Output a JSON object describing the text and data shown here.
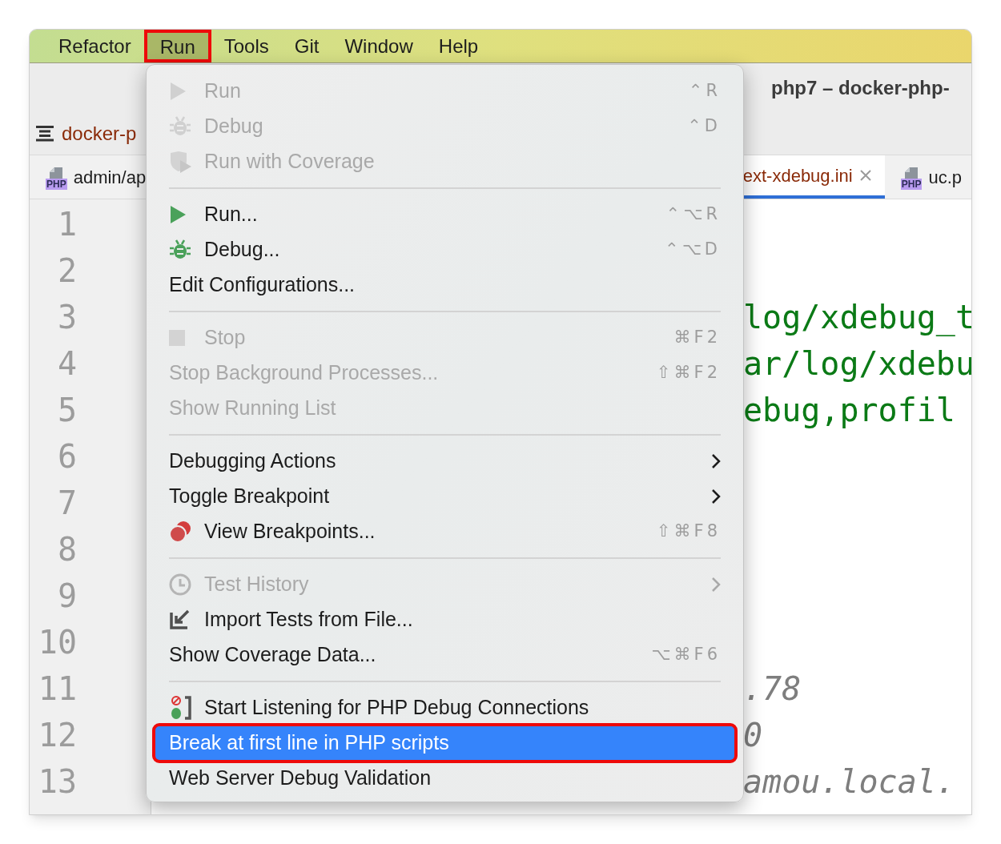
{
  "menubar": [
    {
      "label": "Refactor",
      "selected": false,
      "annotated": false
    },
    {
      "label": "Run",
      "selected": true,
      "annotated": true
    },
    {
      "label": "Tools",
      "selected": false,
      "annotated": false
    },
    {
      "label": "Git",
      "selected": false,
      "annotated": false
    },
    {
      "label": "Window",
      "selected": false,
      "annotated": false
    },
    {
      "label": "Help",
      "selected": false,
      "annotated": false
    }
  ],
  "window": {
    "title": "php7 – docker-php-"
  },
  "navbar": {
    "breadcrumb": "docker-p"
  },
  "tabs": [
    {
      "label": "admin/ap",
      "selected": false,
      "badge": "PHP"
    },
    {
      "label": "ext-xdebug.ini",
      "selected": true,
      "closable": true
    },
    {
      "label": "uc.p",
      "selected": false,
      "badge": "PHP"
    }
  ],
  "editor": {
    "lines": [
      {
        "number": "1"
      },
      {
        "number": "2"
      },
      {
        "number": "3",
        "text": "log/xdebug_t",
        "kind": "string"
      },
      {
        "number": "4",
        "text": "ar/log/xdebu",
        "kind": "string"
      },
      {
        "number": "5",
        "text": "ebug,profil",
        "kind": "string"
      },
      {
        "number": "6"
      },
      {
        "number": "7"
      },
      {
        "number": "8"
      },
      {
        "number": "9"
      },
      {
        "number": "10"
      },
      {
        "number": "11",
        "text": ".78",
        "kind": "value"
      },
      {
        "number": "12",
        "text": "0",
        "kind": "value"
      },
      {
        "number": "13",
        "text": "amou.local.",
        "kind": "value"
      }
    ]
  },
  "menu": {
    "items": [
      {
        "kind": "item",
        "label": "Run",
        "disabled": true,
        "shortcut": "⌃R",
        "selected": false,
        "annotated": false
      },
      {
        "kind": "item",
        "label": "Debug",
        "disabled": true,
        "shortcut": "⌃D",
        "selected": false,
        "annotated": false
      },
      {
        "kind": "item",
        "label": "Run with Coverage",
        "disabled": true,
        "selected": false,
        "annotated": false
      },
      {
        "kind": "separator"
      },
      {
        "kind": "item",
        "label": "Run...",
        "disabled": false,
        "shortcut": "⌃⌥R",
        "selected": false,
        "annotated": false
      },
      {
        "kind": "item",
        "label": "Debug...",
        "disabled": false,
        "shortcut": "⌃⌥D",
        "selected": false,
        "annotated": false
      },
      {
        "kind": "item",
        "label": "Edit Configurations...",
        "disabled": false,
        "selected": false,
        "annotated": false
      },
      {
        "kind": "separator"
      },
      {
        "kind": "item",
        "label": "Stop",
        "disabled": true,
        "shortcut": "⌘F2",
        "selected": false,
        "annotated": false
      },
      {
        "kind": "item",
        "label": "Stop Background Processes...",
        "disabled": true,
        "shortcut": "⇧⌘F2",
        "selected": false,
        "annotated": false
      },
      {
        "kind": "item",
        "label": "Show Running List",
        "disabled": true,
        "selected": false,
        "annotated": false
      },
      {
        "kind": "separator"
      },
      {
        "kind": "item",
        "label": "Debugging Actions",
        "disabled": false,
        "submenu": true,
        "selected": false,
        "annotated": false
      },
      {
        "kind": "item",
        "label": "Toggle Breakpoint",
        "disabled": false,
        "submenu": true,
        "selected": false,
        "annotated": false
      },
      {
        "kind": "item",
        "label": "View Breakpoints...",
        "disabled": false,
        "shortcut": "⇧⌘F8",
        "selected": false,
        "annotated": false
      },
      {
        "kind": "separator"
      },
      {
        "kind": "item",
        "label": "Test History",
        "disabled": true,
        "submenu": true,
        "selected": false,
        "annotated": false
      },
      {
        "kind": "item",
        "label": "Import Tests from File...",
        "disabled": false,
        "selected": false,
        "annotated": false
      },
      {
        "kind": "item",
        "label": "Show Coverage Data...",
        "disabled": false,
        "shortcut": "⌥⌘F6",
        "selected": false,
        "annotated": false
      },
      {
        "kind": "separator"
      },
      {
        "kind": "item",
        "label": "Start Listening for PHP Debug Connections",
        "disabled": false,
        "selected": false,
        "annotated": false
      },
      {
        "kind": "item",
        "label": "Break at first line in PHP scripts",
        "disabled": false,
        "selected": true,
        "annotated": true
      },
      {
        "kind": "item",
        "label": "Web Server Debug Validation",
        "disabled": false,
        "selected": false,
        "annotated": false
      }
    ]
  }
}
